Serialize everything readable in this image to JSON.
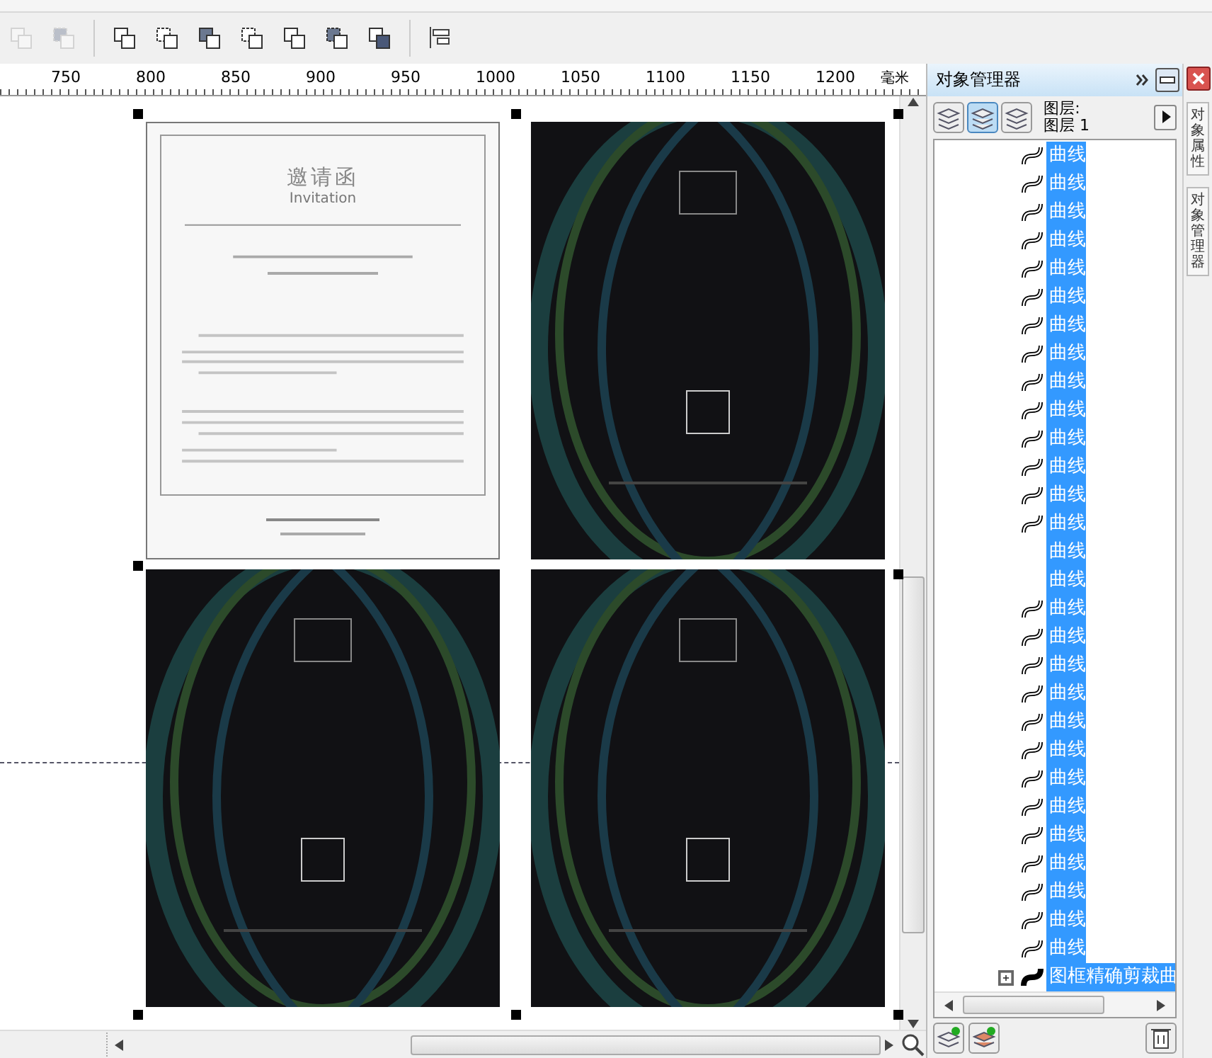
{
  "toolbar": {
    "buttons": [
      {
        "disabled": true
      },
      {
        "disabled": true
      },
      {
        "disabled": false
      },
      {
        "disabled": false
      },
      {
        "disabled": false
      },
      {
        "disabled": false
      },
      {
        "disabled": false
      },
      {
        "disabled": false
      },
      {
        "disabled": false
      },
      {
        "disabled": false
      }
    ]
  },
  "ruler": {
    "labels": [
      "750",
      "800",
      "850",
      "900",
      "950",
      "1000",
      "1050",
      "1100",
      "1150",
      "1200"
    ],
    "unit": "毫米"
  },
  "canvas": {
    "pages": [
      {
        "kind": "invitation",
        "title": "邀请函",
        "subtitle": "Invitation"
      },
      {
        "kind": "dark"
      },
      {
        "kind": "dark"
      },
      {
        "kind": "dark"
      }
    ]
  },
  "object_manager": {
    "title": "对象管理器",
    "layer_label": "图层:",
    "layer_name": "图层 1",
    "items": [
      {
        "kind": "curve",
        "label": "曲线",
        "selected": true
      },
      {
        "kind": "curve",
        "label": "曲线",
        "selected": true
      },
      {
        "kind": "curve",
        "label": "曲线",
        "selected": true
      },
      {
        "kind": "curve",
        "label": "曲线",
        "selected": true
      },
      {
        "kind": "curve",
        "label": "曲线",
        "selected": true
      },
      {
        "kind": "curve",
        "label": "曲线",
        "selected": true
      },
      {
        "kind": "curve",
        "label": "曲线",
        "selected": true
      },
      {
        "kind": "curve",
        "label": "曲线",
        "selected": true
      },
      {
        "kind": "curve",
        "label": "曲线",
        "selected": true
      },
      {
        "kind": "curve",
        "label": "曲线",
        "selected": true
      },
      {
        "kind": "curve",
        "label": "曲线",
        "selected": true
      },
      {
        "kind": "curve",
        "label": "曲线",
        "selected": true
      },
      {
        "kind": "curve",
        "label": "曲线",
        "selected": true
      },
      {
        "kind": "curve",
        "label": "曲线",
        "selected": true
      },
      {
        "kind": "blank",
        "label": "曲线",
        "selected": true
      },
      {
        "kind": "blank",
        "label": "曲线",
        "selected": true
      },
      {
        "kind": "curve",
        "label": "曲线",
        "selected": true
      },
      {
        "kind": "curve",
        "label": "曲线",
        "selected": true
      },
      {
        "kind": "curve",
        "label": "曲线",
        "selected": true
      },
      {
        "kind": "curve",
        "label": "曲线",
        "selected": true
      },
      {
        "kind": "curve",
        "label": "曲线",
        "selected": true
      },
      {
        "kind": "curve",
        "label": "曲线",
        "selected": true
      },
      {
        "kind": "curve",
        "label": "曲线",
        "selected": true
      },
      {
        "kind": "curve",
        "label": "曲线",
        "selected": true
      },
      {
        "kind": "curve",
        "label": "曲线",
        "selected": true
      },
      {
        "kind": "curve",
        "label": "曲线",
        "selected": true
      },
      {
        "kind": "curve",
        "label": "曲线",
        "selected": true
      },
      {
        "kind": "curve",
        "label": "曲线",
        "selected": true
      },
      {
        "kind": "curve",
        "label": "曲线",
        "selected": true
      },
      {
        "kind": "powerclip",
        "label": "图框精确剪裁曲",
        "selected": true,
        "expanded": false
      }
    ]
  },
  "side_tabs": [
    "对象属性",
    "对象管理器"
  ]
}
